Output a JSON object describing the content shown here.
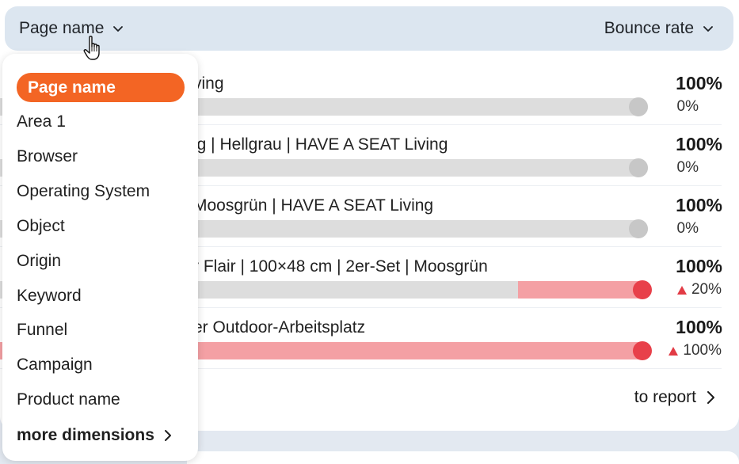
{
  "header": {
    "dimension_label": "Page name",
    "metric_label": "Bounce rate"
  },
  "rows": [
    {
      "label": "ving",
      "value": "100%",
      "delta": "0%",
      "trend": "neutral",
      "change_pct": 0
    },
    {
      "label": "lg | Hellgrau | HAVE A SEAT Living",
      "value": "100%",
      "delta": "0%",
      "trend": "neutral",
      "change_pct": 0
    },
    {
      "label": "Moosgrün | HAVE A SEAT Living",
      "value": "100%",
      "delta": "0%",
      "trend": "neutral",
      "change_pct": 0
    },
    {
      "label": "r Flair | 100×48 cm | 2er-Set | Moosgrün",
      "value": "100%",
      "delta": "20%",
      "trend": "up",
      "change_pct": 20
    },
    {
      "label": "er Outdoor-Arbeitsplatz",
      "value": "100%",
      "delta": "100%",
      "trend": "up",
      "change_pct": 100
    }
  ],
  "footer": {
    "to_report": "to report"
  },
  "dropdown": {
    "items": [
      "Page name",
      "Area 1",
      "Browser",
      "Operating System",
      "Object",
      "Origin",
      "Keyword",
      "Funnel",
      "Campaign",
      "Product name"
    ],
    "selected_index": 0,
    "more": "more dimensions"
  },
  "colors": {
    "accent": "#f36524",
    "header_bg": "#dce6f0",
    "track": "#dddddd",
    "fill_up": "#f4a0a4",
    "knob_up": "#e8404a",
    "knob_neutral": "#c7c7c7"
  },
  "icons": {
    "dimension_toggle": "chevron-down-icon",
    "metric_toggle": "chevron-down-icon",
    "report_link": "chevron-right-icon",
    "more_link": "chevron-right-icon",
    "pointer": "hand-cursor-icon",
    "trend_up": "triangle-up-icon"
  }
}
